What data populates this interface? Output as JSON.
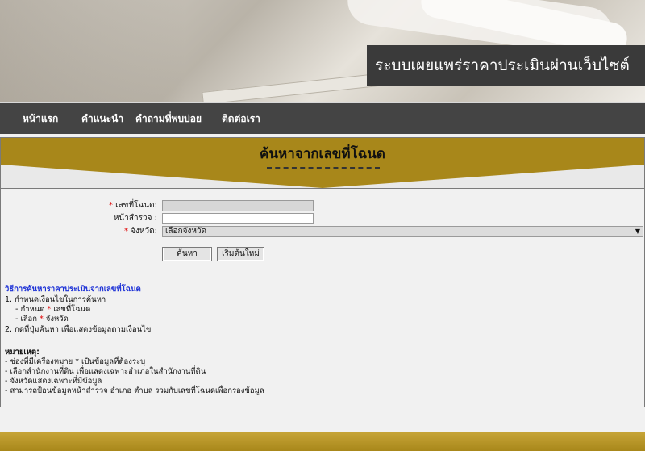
{
  "banner": {
    "title": "ระบบเผยแพร่ราคาประเมินผ่านเว็บไซต์"
  },
  "nav": {
    "items": [
      "หน้าแรก",
      "คำแนะนำ",
      "คำถามที่พบบ่อย",
      "ติดต่อเรา"
    ]
  },
  "search": {
    "title": "ค้นหาจากเลขที่โฉนด",
    "fields": {
      "deed_label": "เลขที่โฉนด:",
      "survey_label": "หน้าสำรวจ :",
      "province_label": "จังหวัด:",
      "province_selected": "เลือกจังหวัด"
    },
    "buttons": {
      "search": "ค้นหา",
      "reset": "เริ่มต้นใหม่"
    }
  },
  "instructions": {
    "heading": "วิธีการค้นหาราคาประเมินจากเลขที่โฉนด",
    "steps": [
      "1. กำหนดเงื่อนไขในการค้นหา",
      "- กำหนด",
      "เลขที่โฉนด",
      "- เลือก",
      "จังหวัด",
      "2. กดที่ปุ่มค้นหา เพื่อแสดงข้อมูลตามเงื่อนไข"
    ],
    "notes_heading": "หมายเหตุ:",
    "notes": [
      "- ช่องที่มีเครื่องหมาย * เป็นข้อมูลที่ต้องระบุ",
      "- เลือกสำนักงานที่ดิน เพื่อแสดงเฉพาะอำเภอในสำนักงานที่ดิน",
      "- จังหวัดแสดงเฉพาะที่มีข้อมูล",
      "- สามารถป้อนข้อมูลหน้าสำรวจ อำเภอ ตำบล รวมกับเลขที่โฉนดเพื่อกรองข้อมูล"
    ]
  },
  "colors": {
    "accent": "#a8871a",
    "nav": "#444444",
    "link": "#1a2fd6",
    "required": "#e00000"
  }
}
